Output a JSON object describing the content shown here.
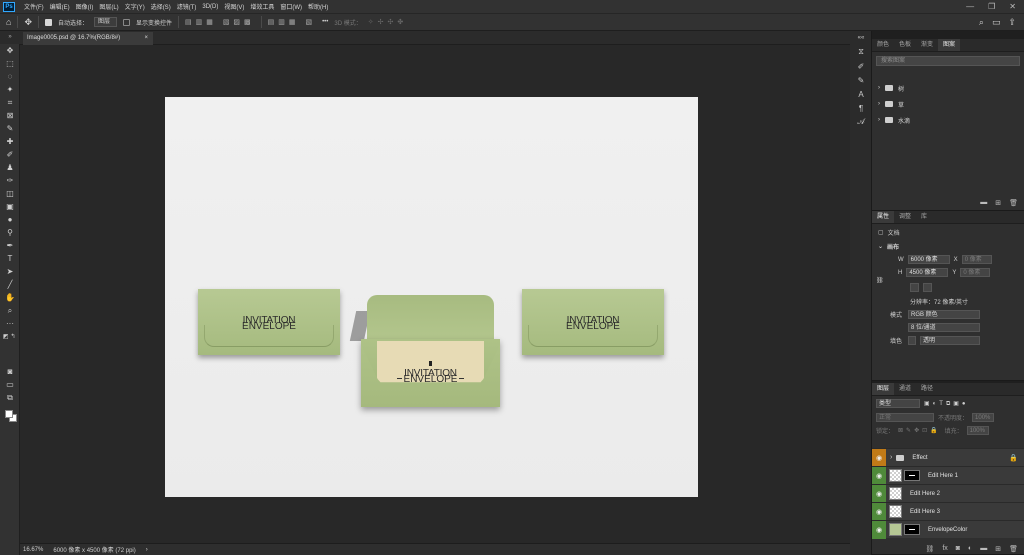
{
  "app": {
    "logo": "Ps",
    "menus": [
      "文件(F)",
      "编辑(E)",
      "图像(I)",
      "图层(L)",
      "文字(Y)",
      "选择(S)",
      "滤镜(T)",
      "3D(D)",
      "视图(V)",
      "增效工具",
      "窗口(W)",
      "帮助(H)"
    ],
    "win_controls": [
      "—",
      "❐",
      "✕"
    ]
  },
  "options": {
    "auto_select_label": "自动选择：",
    "auto_select_value": "图层",
    "transform_label": "显示变换控件",
    "more": "•••",
    "mode_3d": "3D 模式："
  },
  "document": {
    "tab_label": "Image0005.psd @ 16.7%(RGB/8#)",
    "close": "×",
    "envelope_title": "INVITATION",
    "envelope_subtitle": "ENVELOPE"
  },
  "status": {
    "zoom": "16.67%",
    "size": "6000 像素 x 4500 像素 (72 ppi)",
    "arrow": "›"
  },
  "panels": {
    "top_tabs": [
      "颜色",
      "色板",
      "渐变",
      "图案"
    ],
    "top_active": 3,
    "search_placeholder": "搜索图案",
    "pattern_groups": [
      "树",
      "草",
      "水滴"
    ],
    "prop_tabs": [
      "属性",
      "调整",
      "库"
    ],
    "prop_doc_label": "文档",
    "canvas_section": "画布",
    "width_label": "W",
    "width_value": "6000 像素",
    "height_label": "H",
    "height_value": "4500 像素",
    "x_label": "X",
    "x_value": "0 像素",
    "y_label": "Y",
    "y_value": "0 像素",
    "resolution": "分辨率：72 像素/英寸",
    "mode_label": "模式",
    "mode_value": "RGB 颜色",
    "depth_value": "8 位/通道",
    "fill_label": "填色",
    "fill_value": "透明",
    "layer_tabs": [
      "图层",
      "通道",
      "路径"
    ],
    "layer_filter": "类型",
    "blend_mode": "正常",
    "opacity_label": "不透明度：",
    "opacity_value": "100%",
    "lock_label": "锁定：",
    "fill_pct_label": "填充：",
    "fill_pct_value": "100%",
    "layers": [
      {
        "name": "Effect",
        "type": "group",
        "eye": "orange"
      },
      {
        "name": "Edit Here 1",
        "type": "smart-mask",
        "eye": "green"
      },
      {
        "name": "Edit Here 2",
        "type": "smart",
        "eye": "green"
      },
      {
        "name": "Edit Here 3",
        "type": "smart",
        "eye": "green"
      },
      {
        "name": "EnvelopeColor",
        "type": "color-mask",
        "eye": "green"
      }
    ]
  }
}
